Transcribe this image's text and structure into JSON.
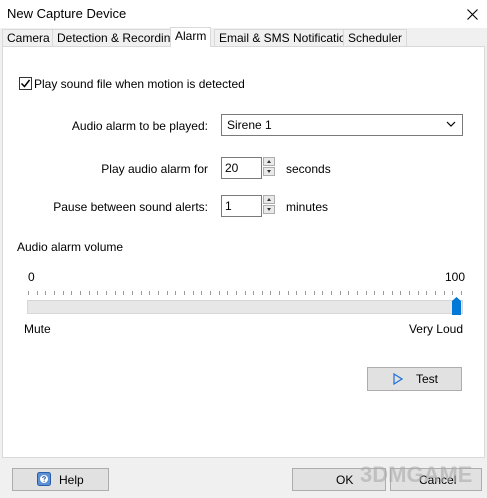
{
  "window": {
    "title": "New Capture Device"
  },
  "tabs": [
    {
      "label": "Camera"
    },
    {
      "label": "Detection & Recording"
    },
    {
      "label": "Alarm"
    },
    {
      "label": "Email & SMS Notifications"
    },
    {
      "label": "Scheduler"
    }
  ],
  "alarm": {
    "play_sound_label": "Play sound file when motion is detected",
    "play_sound_checked": true,
    "audio_alarm_label": "Audio alarm to be played:",
    "audio_alarm_value": "Sirene 1",
    "play_for_label": "Play audio alarm for",
    "play_for_value": "20",
    "play_for_unit": "seconds",
    "pause_label": "Pause between sound alerts:",
    "pause_value": "1",
    "pause_unit": "minutes",
    "volume_label": "Audio alarm volume",
    "volume_min": "0",
    "volume_max": "100",
    "volume_value": 100,
    "volume_min_caption": "Mute",
    "volume_max_caption": "Very Loud",
    "test_label": "Test"
  },
  "footer": {
    "help_label": "Help",
    "ok_label": "OK",
    "cancel_label": "Cancel"
  },
  "watermark": {
    "text": "3DMGAME"
  }
}
